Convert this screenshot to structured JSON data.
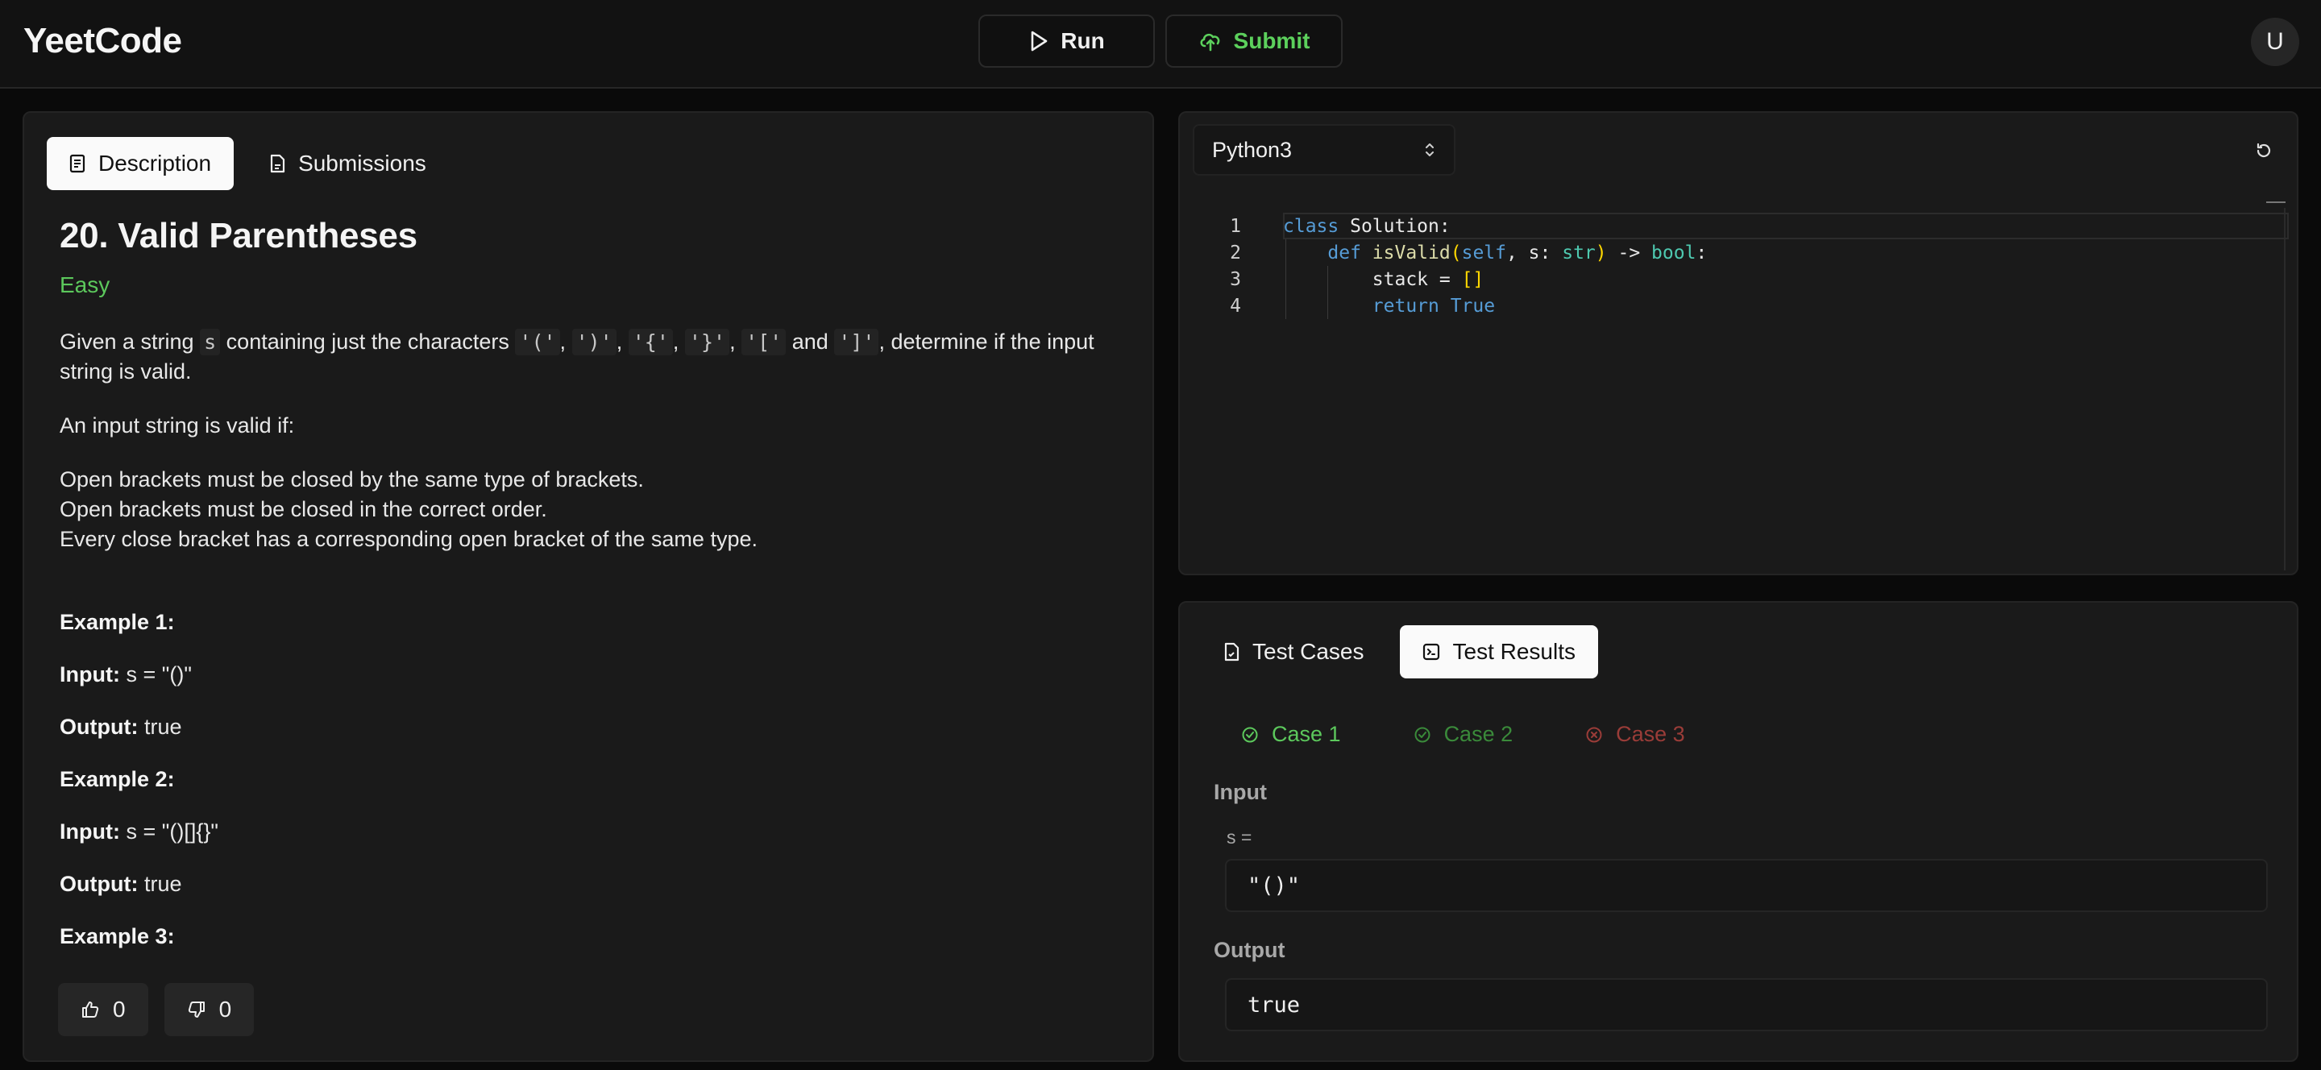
{
  "header": {
    "logo": "YeetCode",
    "run_label": "Run",
    "submit_label": "Submit",
    "avatar_initial": "U"
  },
  "left_panel": {
    "tabs": [
      {
        "label": "Description",
        "icon": "document-icon",
        "active": true
      },
      {
        "label": "Submissions",
        "icon": "file-icon",
        "active": false
      }
    ],
    "problem": {
      "title": "20. Valid Parentheses",
      "difficulty": "Easy",
      "intro_pre": "Given a string",
      "intro_var": "s",
      "intro_mid": "containing just the characters",
      "chars": [
        "'('",
        "')'",
        "'{'",
        "'}'",
        "'['",
        "']'"
      ],
      "intro_and": "and",
      "intro_post": ", determine if the input string is valid.",
      "valid_if": "An input string is valid if:",
      "rules": [
        "Open brackets must be closed by the same type of brackets.",
        "Open brackets must be closed in the correct order.",
        "Every close bracket has a corresponding open bracket of the same type."
      ],
      "examples": [
        {
          "heading": "Example 1:",
          "input_label": "Input:",
          "input": "s = \"()\"",
          "output_label": "Output:",
          "output": "true"
        },
        {
          "heading": "Example 2:",
          "input_label": "Input:",
          "input": "s = \"()[]{}\"",
          "output_label": "Output:",
          "output": "true"
        },
        {
          "heading": "Example 3:"
        }
      ]
    },
    "votes": {
      "likes": "0",
      "dislikes": "0"
    }
  },
  "editor": {
    "language": "Python3",
    "line_numbers": [
      "1",
      "2",
      "3",
      "4"
    ]
  },
  "test_panel": {
    "tabs": [
      {
        "label": "Test Cases",
        "icon": "test-file-icon",
        "active": false
      },
      {
        "label": "Test Results",
        "icon": "terminal-icon",
        "active": true
      }
    ],
    "cases": [
      {
        "label": "Case 1",
        "status": "pass",
        "active": true
      },
      {
        "label": "Case 2",
        "status": "pass",
        "active": false
      },
      {
        "label": "Case 3",
        "status": "fail",
        "active": false
      }
    ],
    "input_label": "Input",
    "var_name": "s =",
    "input_value": "\"()\"",
    "output_label": "Output",
    "output_value": "true"
  },
  "colors": {
    "accent_green": "#5cc85c",
    "fail_red": "#9a3c38",
    "keyword_blue": "#569cd6"
  }
}
